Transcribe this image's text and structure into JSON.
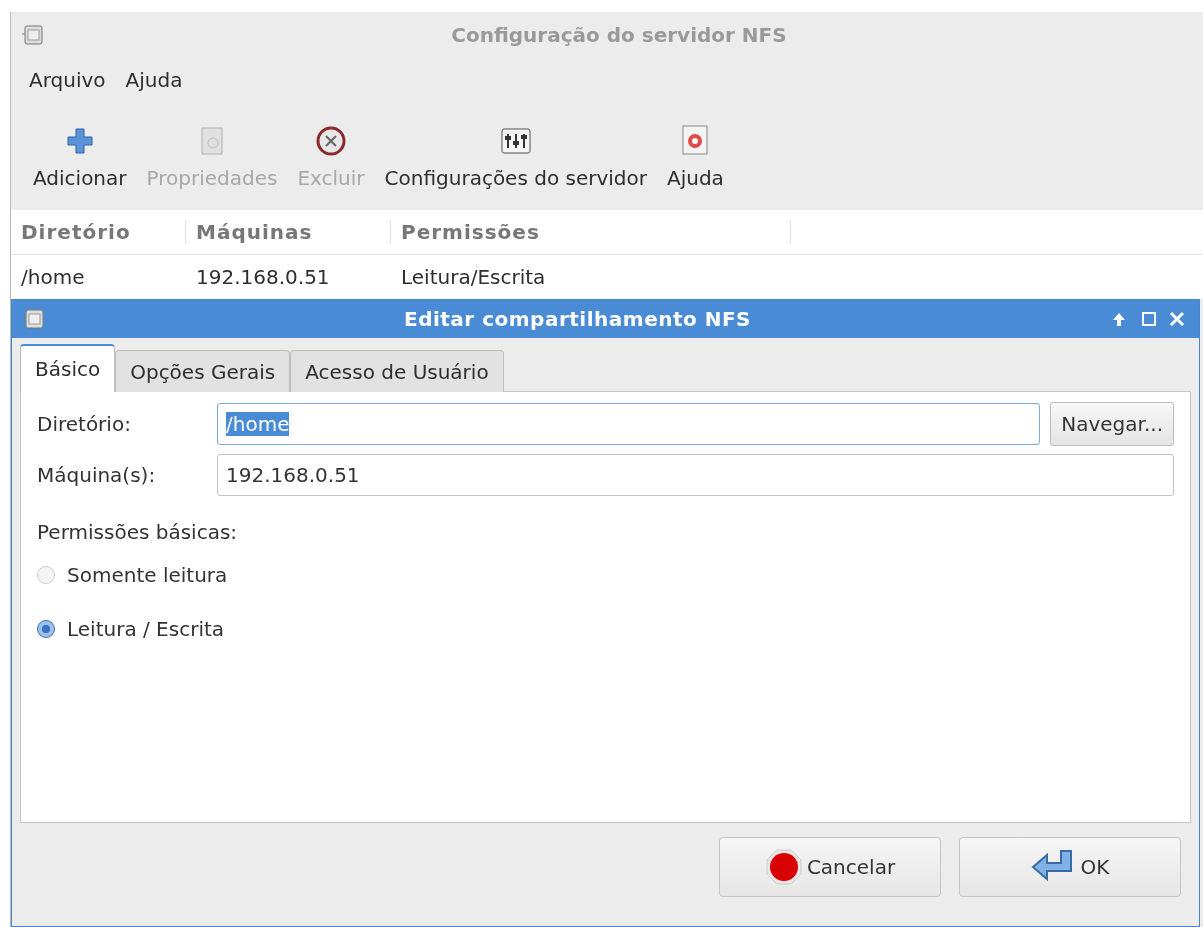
{
  "window": {
    "title": "Configuração do servidor NFS"
  },
  "menu": [
    "Arquivo",
    "Ajuda"
  ],
  "toolbar": [
    {
      "kind": "add",
      "label": "Adicionar",
      "disabled": false
    },
    {
      "kind": "properties",
      "label": "Propriedades",
      "disabled": true
    },
    {
      "kind": "delete",
      "label": "Excluir",
      "disabled": true
    },
    {
      "kind": "settings",
      "label": "Configurações do servidor",
      "disabled": false
    },
    {
      "kind": "help",
      "label": "Ajuda",
      "disabled": false
    }
  ],
  "table": {
    "columns": [
      "Diretório",
      "Máquinas",
      "Permissões"
    ],
    "rows": [
      [
        "/home",
        "192.168.0.51",
        "Leitura/Escrita"
      ]
    ]
  },
  "dialog": {
    "title": "Editar compartilhamento NFS",
    "tabs": [
      {
        "label": "Básico",
        "selected": true
      },
      {
        "label": "Opções Gerais",
        "selected": false
      },
      {
        "label": "Acesso de Usuário",
        "selected": false
      }
    ],
    "directory": {
      "label": "Diretório:",
      "value": "/home",
      "text_selected": true,
      "browse": "Navegar..."
    },
    "hosts": {
      "label": "Máquina(s):",
      "value": "192.168.0.51"
    },
    "permissions": {
      "label": "Permissões básicas:",
      "options": [
        {
          "label": "Somente leitura",
          "selected": false
        },
        {
          "label": "Leitura / Escrita",
          "selected": true
        }
      ]
    },
    "buttons": [
      {
        "kind": "cancel",
        "label": "Cancelar"
      },
      {
        "kind": "ok",
        "label": "OK"
      }
    ]
  }
}
